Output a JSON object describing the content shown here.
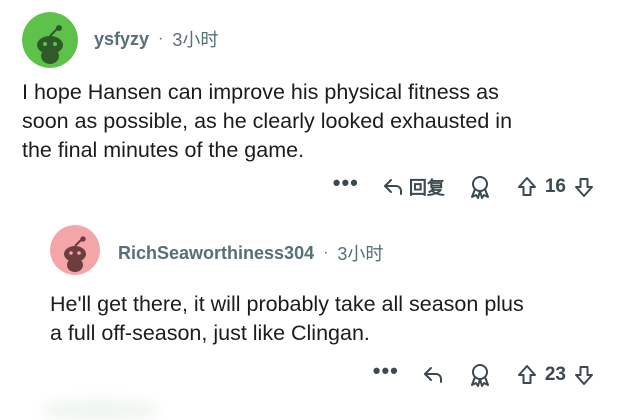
{
  "comments": [
    {
      "username": "ysfyzy",
      "separator": "·",
      "time": "3小时",
      "avatar_color": "#5ec24a",
      "body_lines": [
        "I hope Hansen can improve his physical fitness as",
        "soon as possible, as he clearly looked exhausted in",
        "the final minutes of the game."
      ],
      "actions": {
        "more": "•••",
        "reply_label": "回复",
        "vote_count": "16"
      }
    },
    {
      "username": "RichSeaworthiness304",
      "separator": "·",
      "time": "3小时",
      "avatar_color": "#f4a5a7",
      "body_lines": [
        "He'll get there, it will probably take all season plus",
        "a full off-season, just like Clingan."
      ],
      "actions": {
        "more": "•••",
        "vote_count": "23"
      }
    }
  ],
  "icons": {
    "avatar": "snoo-avatar-icon",
    "reply": "reply-arrow-icon",
    "award": "award-icon",
    "upvote": "upvote-arrow-icon",
    "downvote": "downvote-arrow-icon",
    "more": "more-options-icon"
  },
  "colors": {
    "text": "#1c1c1c",
    "meta": "#576f76",
    "icon": "#3b4a50"
  }
}
